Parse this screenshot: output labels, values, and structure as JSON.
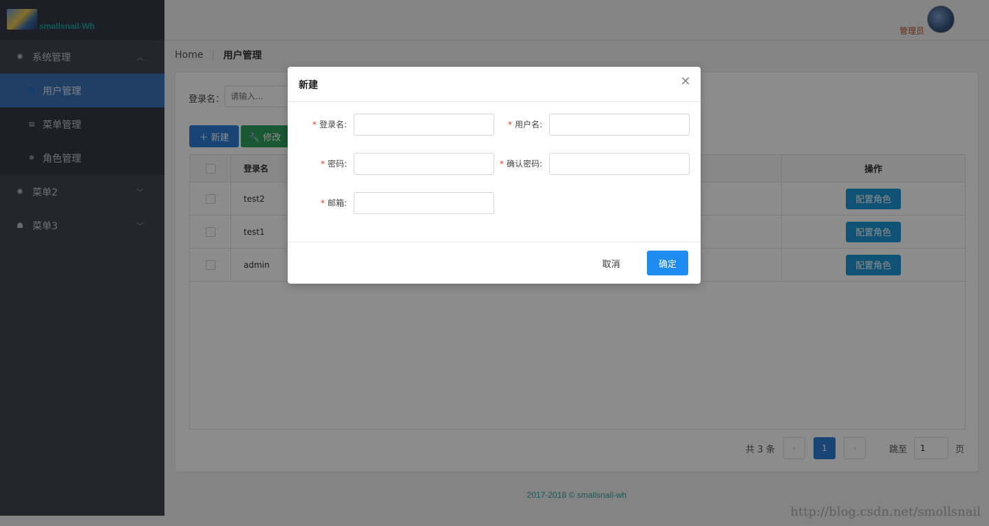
{
  "app": {
    "logo_text": "smallsnail-Wh"
  },
  "sidebar": {
    "groups": [
      {
        "label": "系统管理",
        "icon": "gear-icon",
        "expanded": true,
        "items": [
          {
            "label": "用户管理",
            "icon": "user-icon",
            "active": true
          },
          {
            "label": "菜单管理",
            "icon": "list-icon",
            "active": false
          },
          {
            "label": "角色管理",
            "icon": "group-icon",
            "active": false
          }
        ]
      },
      {
        "label": "菜单2",
        "icon": "gear-icon",
        "expanded": false
      },
      {
        "label": "菜单3",
        "icon": "bug-icon",
        "expanded": false
      }
    ]
  },
  "header": {
    "user_label": "管理员"
  },
  "breadcrumb": {
    "home": "Home",
    "current": "用户管理"
  },
  "search": {
    "label": "登录名：",
    "placeholder": "请输入..."
  },
  "toolbar": {
    "new_label": "新建",
    "edit_label": "修改"
  },
  "table": {
    "headers": {
      "login_name": "登录名",
      "operation": "操作"
    },
    "rows": [
      {
        "login_name": "test2",
        "action": "配置角色"
      },
      {
        "login_name": "test1",
        "action": "配置角色"
      },
      {
        "login_name": "admin",
        "action": "配置角色"
      }
    ]
  },
  "pagination": {
    "total": "共 3 条",
    "current_page": "1",
    "jump_label": "跳至",
    "jump_value": "1",
    "page_suffix": "页"
  },
  "footer": {
    "text": "2017-2018 © smallsnail-wh"
  },
  "watermark": "http://blog.csdn.net/smollsnail",
  "modal": {
    "title": "新建",
    "fields": {
      "login_name": "登录名:",
      "user_name": "用户名:",
      "password": "密码:",
      "confirm_password": "确认密码:",
      "email": "邮箱:"
    },
    "cancel_label": "取消",
    "ok_label": "确定"
  },
  "colors": {
    "primary": "#1f8cf2",
    "sidebar_bg": "#404552",
    "required": "#e03a22",
    "success": "#2ea05c"
  }
}
